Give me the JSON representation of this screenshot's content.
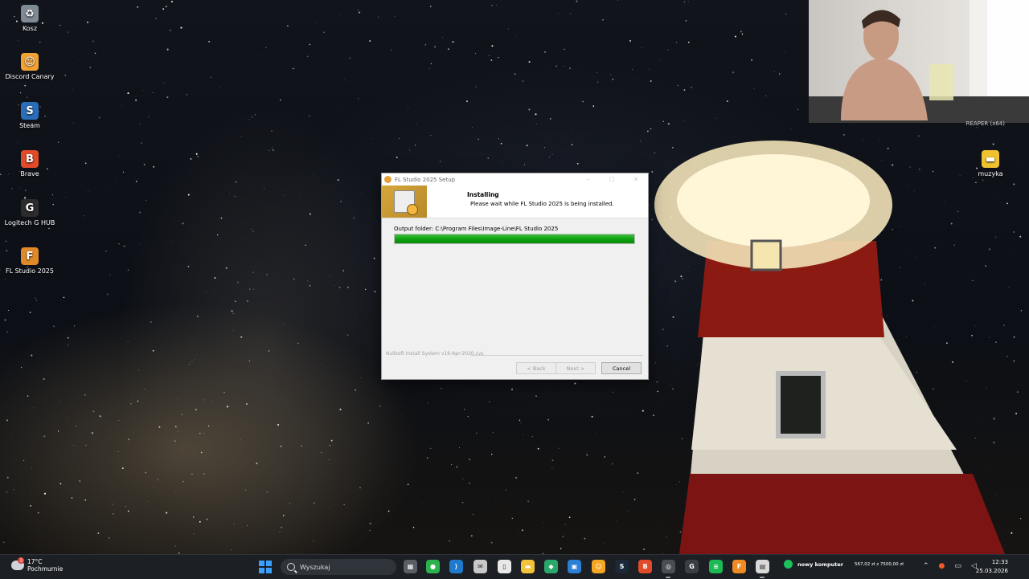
{
  "desktop": {
    "icons": [
      {
        "label": "Kosz",
        "icon": "recycle-bin-icon"
      },
      {
        "label": "Discord Canary",
        "icon": "discord-icon"
      },
      {
        "label": "Steam",
        "icon": "steam-icon"
      },
      {
        "label": "Brave",
        "icon": "brave-icon"
      },
      {
        "label": "Logitech G HUB",
        "icon": "logitech-icon"
      },
      {
        "label": "FL Studio 2025",
        "icon": "fl-studio-icon"
      },
      {
        "label": "muzyka",
        "icon": "folder-icon"
      }
    ],
    "webcam_caption": "REAPER (x64)"
  },
  "setup_window": {
    "title": "FL Studio 2025 Setup",
    "heading": "Installing",
    "subheading": "Please wait while FL Studio 2025 is being installed.",
    "output_folder": "Output folder: C:\\Program Files\\Image-Line\\FL Studio 2025",
    "progress": 1.0,
    "branding": "Nullsoft Install System v16-Apr-2020.cvs",
    "buttons": {
      "back": "< Back",
      "next": "Next >",
      "cancel": "Cancel"
    },
    "controls": {
      "minimize": "–",
      "maximize": "☐",
      "close": "✕"
    }
  },
  "taskbar": {
    "weather": {
      "temp": "17°C",
      "condition": "Pochmurnie",
      "badge": "3"
    },
    "search_placeholder": "Wyszukaj",
    "pinned_icons": [
      "task-view-icon",
      "monitor-app-icon",
      "vscode-icon",
      "mail-icon",
      "file-icon",
      "file-explorer-icon",
      "brave-icon",
      "photos-icon",
      "discord-icon",
      "steam-icon",
      "brave-icon",
      "chrome-icon",
      "logitech-icon",
      "spotify-icon",
      "fl-studio-icon",
      "installer-icon"
    ],
    "budget": {
      "label": "nowy komputer",
      "value": "567,02 zł z 7500,00 zł"
    },
    "clock": {
      "time": "12:33",
      "date": "25.03.2026"
    },
    "colors": {
      "accent": "#3aa0ff",
      "progress": "#1aa31a"
    }
  }
}
